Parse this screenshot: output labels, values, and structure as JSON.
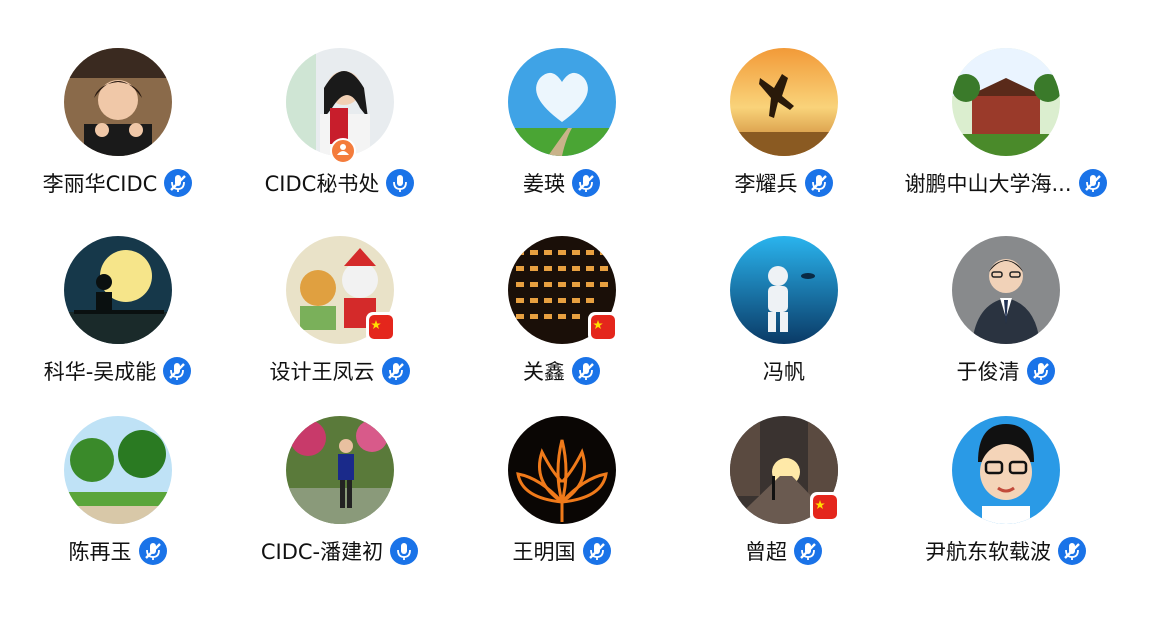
{
  "participants": [
    {
      "name": "李丽华CIDC",
      "mic": "muted",
      "badge": ""
    },
    {
      "name": "CIDC秘书处",
      "mic": "active",
      "badge": "host"
    },
    {
      "name": "姜瑛",
      "mic": "muted",
      "badge": ""
    },
    {
      "name": "李耀兵",
      "mic": "muted",
      "badge": ""
    },
    {
      "name": "谢鹏中山大学海...",
      "mic": "muted",
      "badge": ""
    },
    {
      "name": "科华-吴成能",
      "mic": "muted",
      "badge": ""
    },
    {
      "name": "设计王凤云",
      "mic": "muted",
      "badge": "flag"
    },
    {
      "name": "关鑫",
      "mic": "muted",
      "badge": "flag"
    },
    {
      "name": "冯帆",
      "mic": "none",
      "badge": ""
    },
    {
      "name": "于俊清",
      "mic": "muted",
      "badge": ""
    },
    {
      "name": "陈再玉",
      "mic": "muted",
      "badge": ""
    },
    {
      "name": "CIDC-潘建初",
      "mic": "active",
      "badge": ""
    },
    {
      "name": "王明国",
      "mic": "muted",
      "badge": ""
    },
    {
      "name": "曾超",
      "mic": "muted",
      "badge": "flag"
    },
    {
      "name": "尹航东软载波",
      "mic": "muted",
      "badge": ""
    }
  ],
  "colors": {
    "mic_blue": "#1a73e8",
    "host_badge": "#f47c3c",
    "flag_red": "#e4261c"
  }
}
